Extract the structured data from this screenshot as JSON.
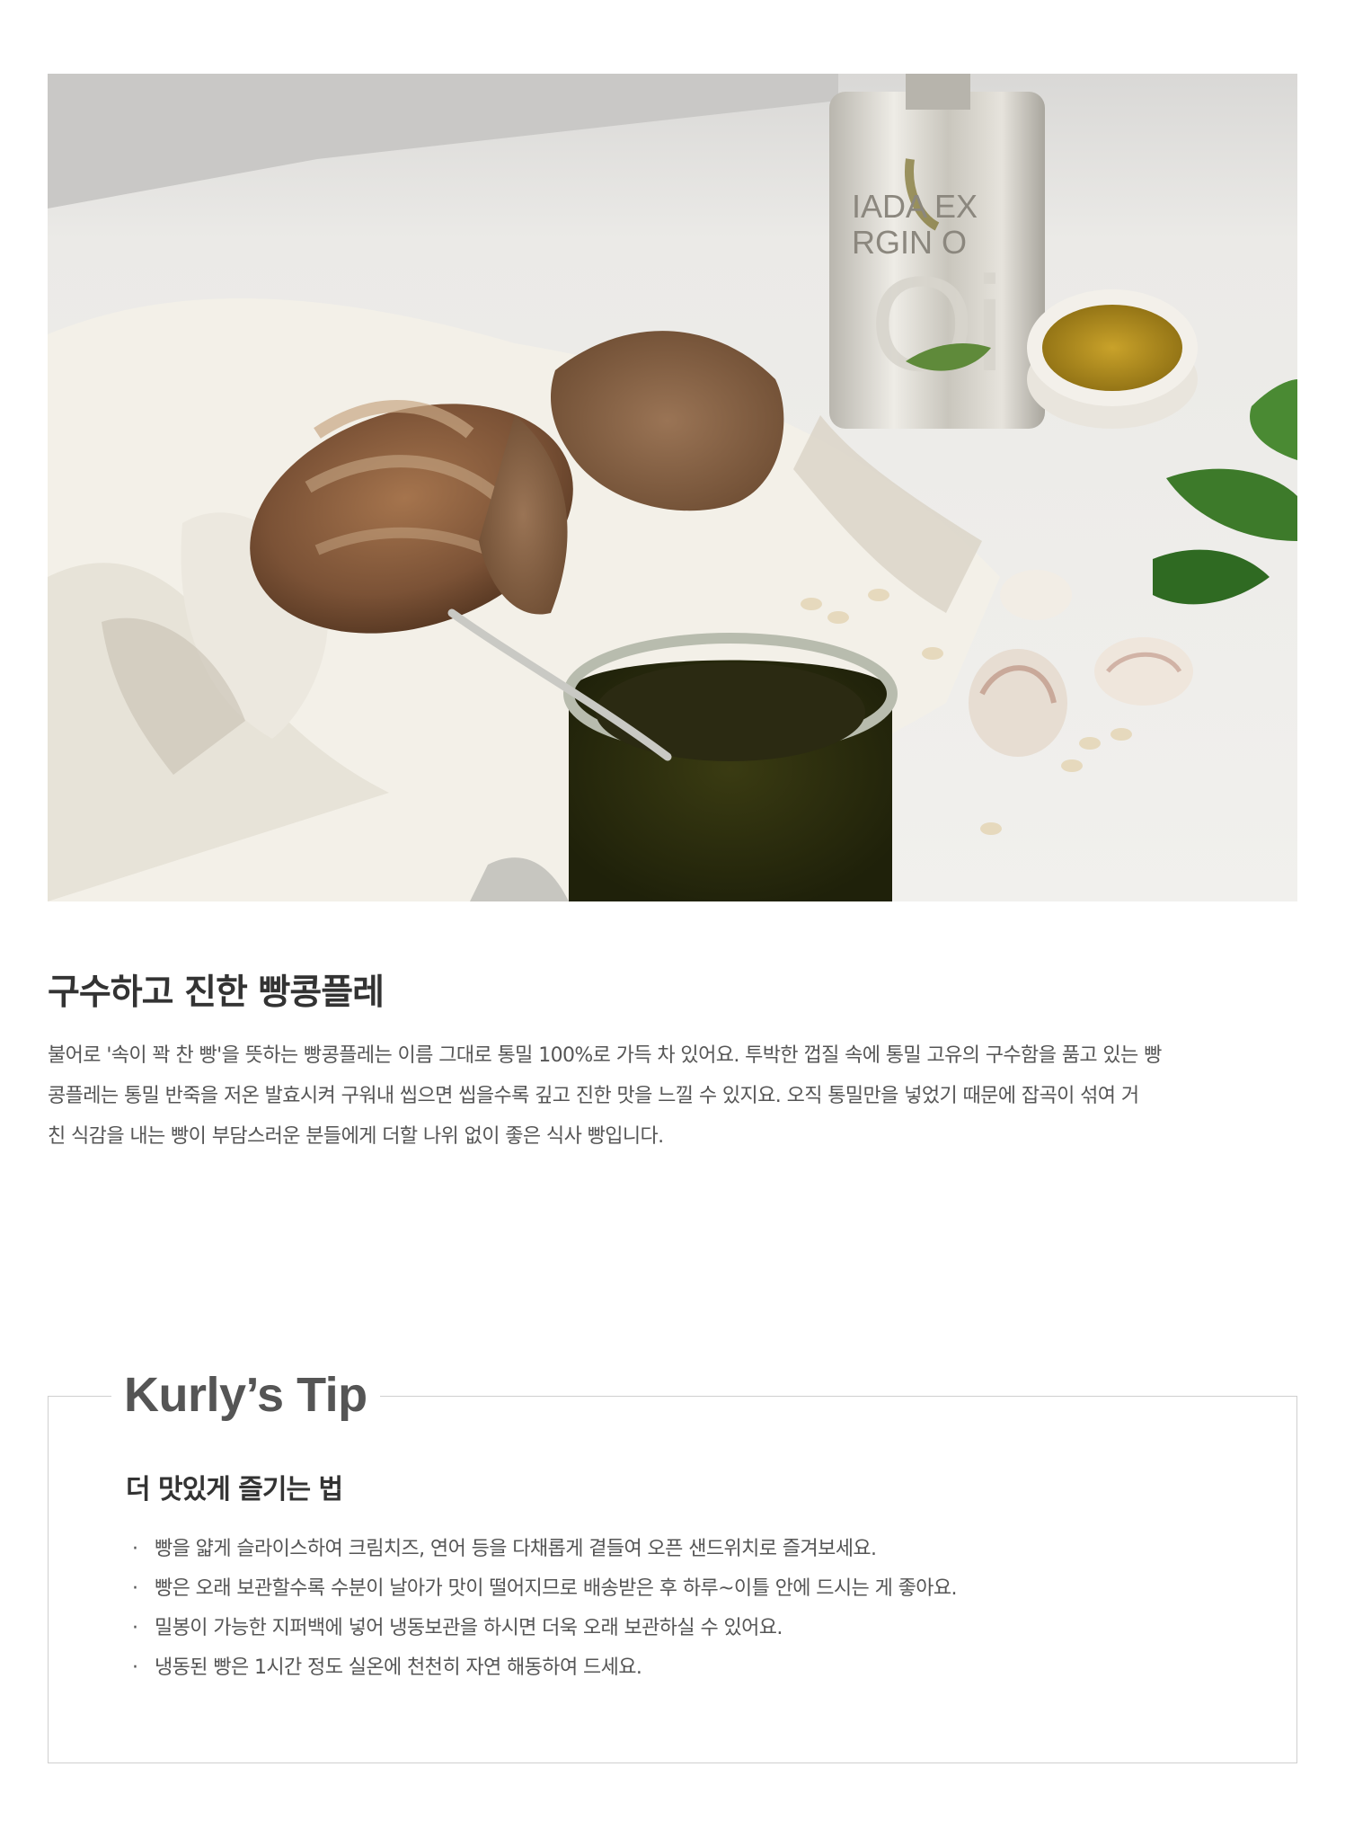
{
  "hero_image": {
    "tin_text": [
      "IADA EX",
      "RGIN O"
    ],
    "tin_logo": "Oi"
  },
  "product": {
    "heading": "구수하고 진한 빵콩플레",
    "description": [
      "불어로 '속이 꽉 찬 빵'을 뜻하는 빵콩플레는 이름 그대로 통밀 100%로 가득 차 있어요. 투박한 껍질 속에 통밀 고유의 구수함을 품고 있는 빵",
      "콩플레는 통밀 반죽을 저온 발효시켜 구워내 씹으면 씹을수록 깊고 진한 맛을 느낄 수 있지요. 오직 통밀만을 넣었기 때문에 잡곡이 섞여 거",
      "친 식감을 내는 빵이 부담스러운 분들에게 더할 나위 없이 좋은 식사 빵입니다."
    ]
  },
  "tip": {
    "title": "Kurly’s Tip",
    "subtitle": "더 맛있게 즐기는 법",
    "bullet": "·",
    "items": [
      "빵을 얇게 슬라이스하여 크림치즈, 연어 등을 다채롭게 곁들여 오픈 샌드위치로 즐겨보세요.",
      "빵은 오래 보관할수록 수분이 날아가 맛이 떨어지므로 배송받은 후 하루~이틀 안에 드시는 게 좋아요.",
      "밀봉이 가능한 지퍼백에 넣어 냉동보관을 하시면 더욱 오래 보관하실 수 있어요.",
      "냉동된 빵은 1시간 정도 실온에 천천히 자연 해동하여 드세요."
    ]
  }
}
